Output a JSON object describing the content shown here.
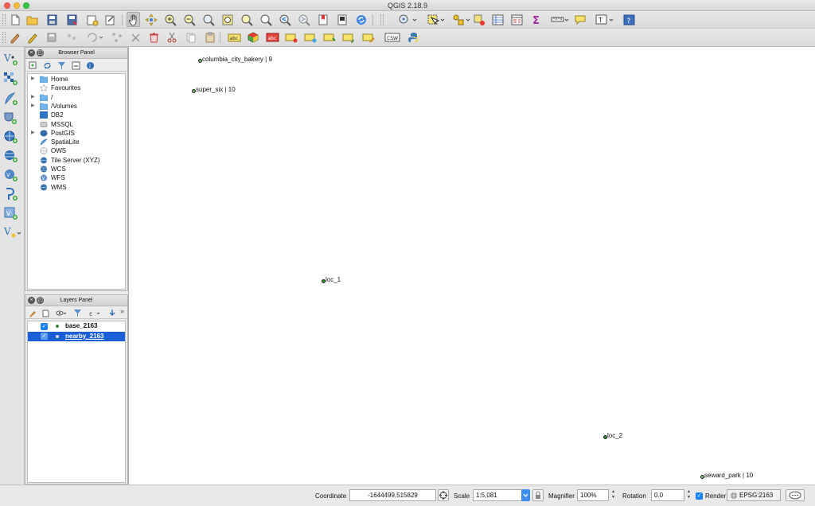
{
  "window": {
    "title": "QGIS 2.18.9"
  },
  "toolbar1": {
    "icons": [
      "new-project-icon",
      "open-project-icon",
      "save-project-icon",
      "save-as-icon",
      "new-print-composer-icon",
      "composer-manager-icon",
      "pan-icon",
      "pan-to-selection-icon",
      "zoom-in-icon",
      "zoom-out-icon",
      "zoom-full-icon",
      "zoom-to-selection-icon",
      "zoom-to-layer-icon",
      "zoom-native-icon",
      "zoom-last-icon",
      "zoom-next-icon",
      "new-bookmark-icon",
      "refresh-icon",
      "identify-icon",
      "select-features-icon",
      "deselect-icon",
      "measure-icon",
      "open-attribute-table-icon",
      "field-calculator-icon",
      "statistical-summary-icon",
      "measure-line-icon",
      "map-tips-icon",
      "text-annotation-icon",
      "help-icon"
    ]
  },
  "toolbar2": {
    "csw_label": "CSW",
    "label_tool_text": "abc"
  },
  "vertical_toolbar": {
    "icons": [
      "add-vector-layer-icon",
      "add-raster-layer-icon",
      "add-delimited-text-layer-icon",
      "add-spatialite-layer-icon",
      "add-postgis-layer-icon",
      "add-wms-layer-icon",
      "add-wcs-layer-icon",
      "add-wfs-layer-icon",
      "add-virtual-layer-icon",
      "add-oracle-layer-icon",
      "new-shapefile-layer-icon"
    ]
  },
  "browser_panel": {
    "title": "Browser Panel",
    "items": [
      {
        "label": "Home",
        "expandable": true,
        "icon": "folder-icon"
      },
      {
        "label": "Favourites",
        "expandable": false,
        "icon": "star-icon"
      },
      {
        "label": "/",
        "expandable": true,
        "icon": "folder-icon"
      },
      {
        "label": "/Volumes",
        "expandable": true,
        "icon": "folder-icon"
      },
      {
        "label": "DB2",
        "expandable": false,
        "icon": "db2-icon"
      },
      {
        "label": "MSSQL",
        "expandable": false,
        "icon": "mssql-icon"
      },
      {
        "label": "PostGIS",
        "expandable": true,
        "icon": "postgis-icon"
      },
      {
        "label": "SpatiaLite",
        "expandable": false,
        "icon": "spatialite-icon"
      },
      {
        "label": "OWS",
        "expandable": false,
        "icon": "ows-icon"
      },
      {
        "label": "Tile Server (XYZ)",
        "expandable": false,
        "icon": "tile-server-icon"
      },
      {
        "label": "WCS",
        "expandable": false,
        "icon": "wcs-icon"
      },
      {
        "label": "WFS",
        "expandable": false,
        "icon": "wfs-icon"
      },
      {
        "label": "WMS",
        "expandable": false,
        "icon": "wms-icon"
      }
    ]
  },
  "layers_panel": {
    "title": "Layers Panel",
    "layers": [
      {
        "name": "base_2163",
        "checked": true,
        "selected": false,
        "symbol_color": "#3a8a3a"
      },
      {
        "name": "nearby_2163",
        "checked": true,
        "selected": true,
        "symbol_color": "#d8d8ff"
      }
    ]
  },
  "map": {
    "features": [
      {
        "label": "columbia_city_bakery | 9",
        "layer": "base_2163"
      },
      {
        "label": "super_six | 10",
        "layer": "base_2163"
      },
      {
        "label": "loc_1",
        "layer": "nearby_2163"
      },
      {
        "label": "loc_2",
        "layer": "nearby_2163"
      },
      {
        "label": "seward_park | 10",
        "layer": "base_2163"
      }
    ]
  },
  "statusbar": {
    "coordinate_label": "Coordinate",
    "coordinate_value": "-1644499,515829",
    "scale_label": "Scale",
    "scale_value": "1:5,081",
    "magnifier_label": "Magnifier",
    "magnifier_value": "100%",
    "rotation_label": "Rotation",
    "rotation_value": "0.0",
    "render_label": "Render",
    "render_checked": true,
    "crs_value": "EPSG:2163"
  },
  "colors": {
    "selection": "#1a5fd6",
    "checkbox": "#1a82fb",
    "point_green": "#2f9b2f"
  }
}
